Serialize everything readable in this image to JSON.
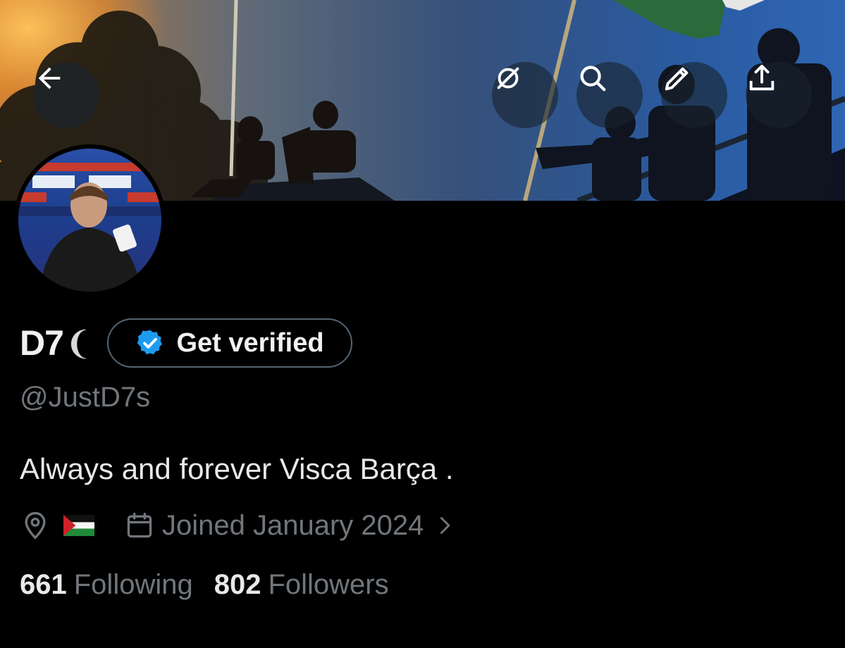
{
  "header": {
    "back_icon": "arrow-left-icon",
    "actions": [
      "grok-icon",
      "search-icon",
      "edit-icon",
      "share-icon"
    ]
  },
  "profile": {
    "display_name": "D7",
    "name_glyph": "❨",
    "handle": "@JustD7s",
    "bio": "Always and forever Visca Barça .",
    "verify_label": "Get verified",
    "location_flag": "palestine-flag",
    "joined": "Joined January 2024",
    "following_count": "661",
    "following_label": "Following",
    "followers_count": "802",
    "followers_label": "Followers"
  },
  "colors": {
    "background": "#000000",
    "text": "#e7e9ea",
    "secondary_text": "#71767b",
    "verified_blue": "#1d9bf0"
  }
}
